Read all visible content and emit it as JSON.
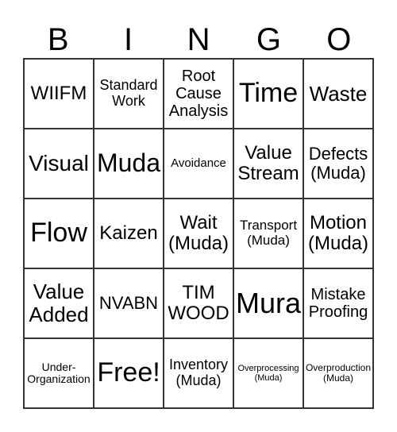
{
  "header": [
    "B",
    "I",
    "N",
    "G",
    "O"
  ],
  "cells": [
    "WIIFM",
    "Standard Work",
    "Root Cause Analysis",
    "Time",
    "Waste",
    "Visual",
    "Muda",
    "Avoidance",
    "Value Stream",
    "Defects (Muda)",
    "Flow",
    "Kaizen",
    "Wait (Muda)",
    "Transport (Muda)",
    "Motion (Muda)",
    "Value Added",
    "NVABN",
    "TIM WOOD",
    "Mura",
    "Mistake Proofing",
    "Under-Organization",
    "Free!",
    "Inventory (Muda)",
    "Overprocessing (Muda)",
    "Overproduction (Muda)"
  ]
}
